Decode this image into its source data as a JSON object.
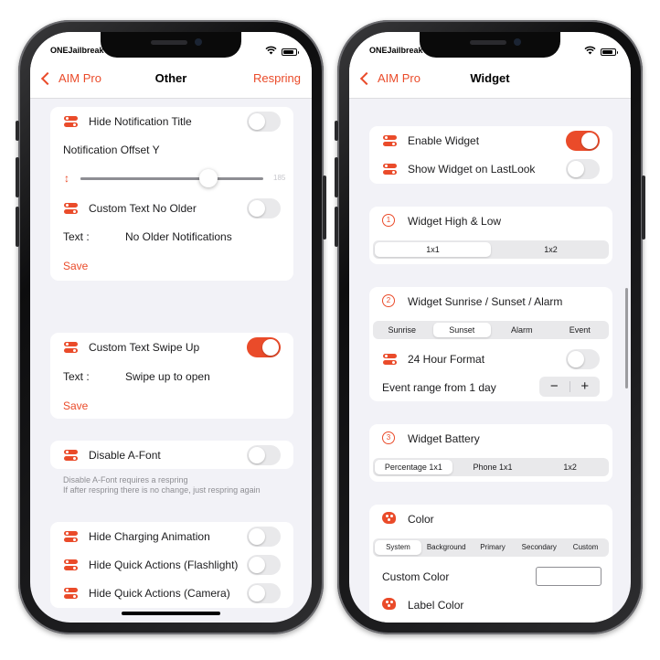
{
  "left": {
    "status": {
      "carrier": "ONEJailbreak"
    },
    "nav": {
      "back": "AIM Pro",
      "title": "Other",
      "action": "Respring"
    },
    "card1": {
      "hide_title": "Hide Notification Title",
      "offset_label": "Notification Offset Y",
      "slider_value": "185",
      "slider_fraction": 0.7,
      "custom_no_older": "Custom Text No Older",
      "text_label": "Text :",
      "text_value": "No Older Notifications",
      "save": "Save"
    },
    "card2": {
      "swipe_up": "Custom Text Swipe Up",
      "text_label": "Text :",
      "text_value": "Swipe up to open",
      "save": "Save"
    },
    "card3": {
      "disable_font": "Disable A-Font"
    },
    "footer": {
      "line1": "Disable A-Font requires a respring",
      "line2": "If after respring there is no change, just respring again"
    },
    "card4": {
      "charging": "Hide Charging Animation",
      "flashlight": "Hide Quick Actions (Flashlight)",
      "camera": "Hide Quick Actions (Camera)"
    }
  },
  "right": {
    "status": {
      "carrier": "ONEJailbreak"
    },
    "nav": {
      "back": "AIM Pro",
      "title": "Widget"
    },
    "card1": {
      "enable": "Enable Widget",
      "lastlook": "Show Widget on LastLook"
    },
    "card2": {
      "num": "1",
      "title": "Widget High & Low",
      "seg": [
        "1x1",
        "1x2"
      ]
    },
    "card3": {
      "num": "2",
      "title": "Widget Sunrise / Sunset / Alarm",
      "seg": [
        "Sunrise",
        "Sunset",
        "Alarm",
        "Event"
      ],
      "hour_format": "24 Hour Format",
      "event_range": "Event range from 1 day",
      "minus": "−",
      "plus": "+"
    },
    "card4": {
      "num": "3",
      "title": "Widget Battery",
      "seg": [
        "Percentage 1x1",
        "Phone 1x1",
        "1x2"
      ]
    },
    "card5": {
      "title": "Color",
      "seg": [
        "System",
        "Background",
        "Primary",
        "Secondary",
        "Custom"
      ],
      "custom_color": "Custom Color",
      "label_color": "Label Color"
    }
  },
  "colors": {
    "accent": "#ea4b2a",
    "background": "#f2f2f7",
    "switch_off": "#e9e9eb"
  }
}
